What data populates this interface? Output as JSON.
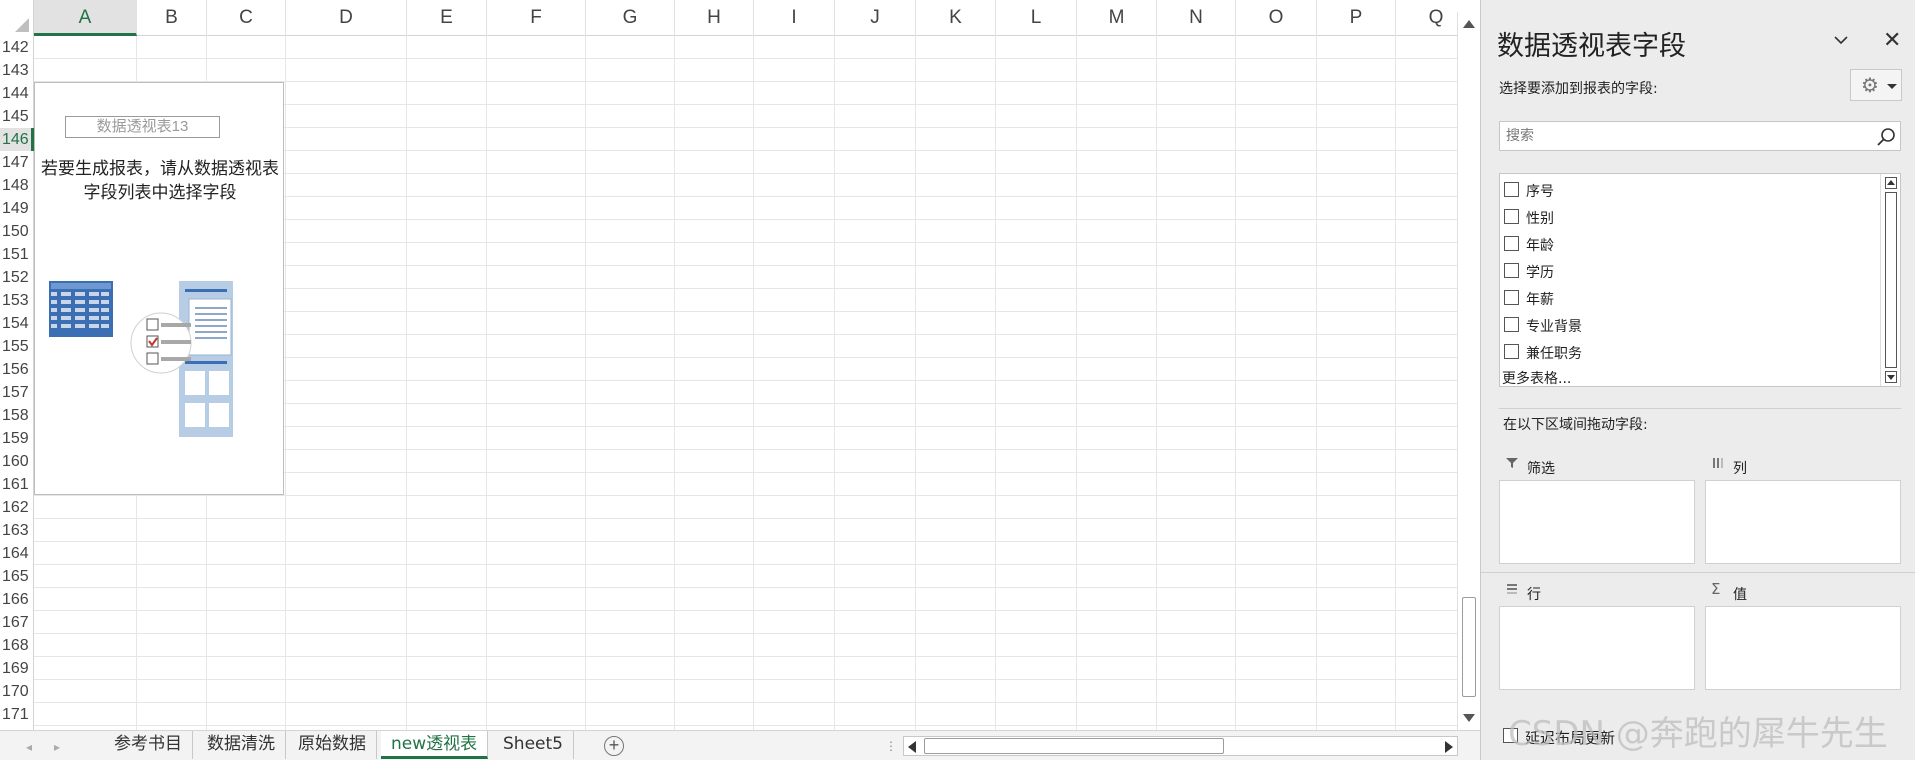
{
  "sheet": {
    "columns": [
      "A",
      "B",
      "C",
      "D",
      "E",
      "F",
      "G",
      "H",
      "I",
      "J",
      "K",
      "L",
      "M",
      "N",
      "O",
      "P",
      "Q"
    ],
    "selected_column": "A",
    "rows": [
      "142",
      "143",
      "144",
      "145",
      "146",
      "147",
      "148",
      "149",
      "150",
      "151",
      "152",
      "153",
      "154",
      "155",
      "156",
      "157",
      "158",
      "159",
      "160",
      "161",
      "162",
      "163",
      "164",
      "165",
      "166",
      "167",
      "168",
      "169",
      "170",
      "171"
    ],
    "selected_row": "146"
  },
  "pivot_placeholder": {
    "name": "数据透视表13",
    "hint": "若要生成报表，请从数据透视表字段列表中选择字段"
  },
  "tabs": {
    "items": [
      "参考书目",
      "数据清洗",
      "原始数据",
      "new透视表",
      "Sheet5"
    ],
    "active": "new透视表",
    "add_icon": "plus-circle-icon"
  },
  "pane": {
    "title": "数据透视表字段",
    "subtitle": "选择要添加到报表的字段:",
    "search_placeholder": "搜索",
    "fields": [
      "序号",
      "性别",
      "年龄",
      "学历",
      "年薪",
      "专业背景",
      "兼任职务"
    ],
    "more_tables": "更多表格...",
    "drag_hint": "在以下区域间拖动字段:",
    "areas": {
      "filter": {
        "label": "筛选",
        "icon": "filter-icon"
      },
      "columns": {
        "label": "列",
        "icon": "columns-icon"
      },
      "rows": {
        "label": "行",
        "icon": "rows-icon"
      },
      "values": {
        "label": "值",
        "icon": "sigma-icon"
      }
    },
    "defer_label": "延迟布局更新"
  },
  "watermark": "CSDN @奔跑的犀牛先生",
  "colors": {
    "accent": "#217346",
    "pane_bg": "#ececec"
  }
}
